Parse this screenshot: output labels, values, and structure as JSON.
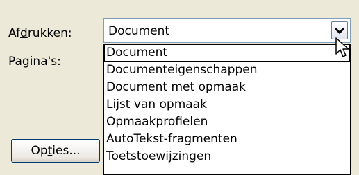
{
  "print_label": "Afdrukken:",
  "pages_label": "Pagina's:",
  "print_select": {
    "value": "Document",
    "options": [
      "Document",
      "Documenteigenschappen",
      "Document met opmaak",
      "Lijst van opmaak",
      "Opmaakprofielen",
      "AutoTekst-fragmenten",
      "Toetstoewijzingen"
    ],
    "highlighted_index": 0
  },
  "options_button": "Opties...",
  "icons": {
    "dropdown_arrow": "chevron-down-icon",
    "cursor": "mouse-pointer-icon"
  },
  "colors": {
    "dialog_bg": "#ece9d8",
    "field_border": "#7f9db9",
    "button_border": "#003c74"
  }
}
